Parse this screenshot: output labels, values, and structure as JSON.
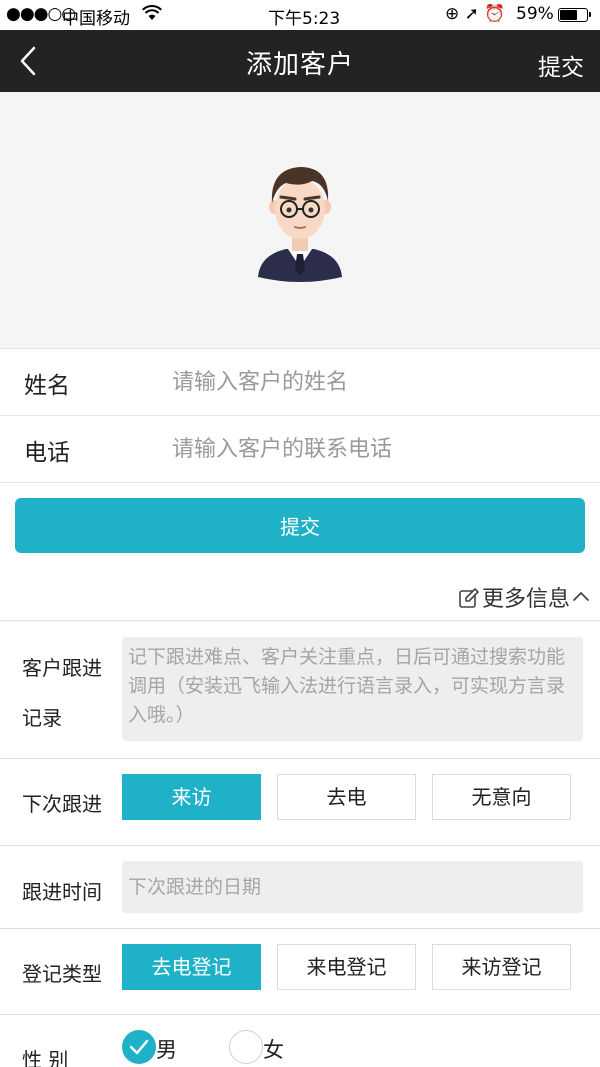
{
  "status_bar": {
    "signal": "●●●○○",
    "carrier": "中国移动",
    "time": "下午5:23",
    "icons": "⊕ ➚ ⏰",
    "battery_text": "59%",
    "battery_level": 0.59
  },
  "nav": {
    "title": "添加客户",
    "submit_label": "提交"
  },
  "form": {
    "name_label": "姓名",
    "name_placeholder": "请输入客户的姓名",
    "phone_label": "电话",
    "phone_placeholder": "请输入客户的联系电话",
    "submit_label": "提交"
  },
  "more_info": {
    "label": "更多信息"
  },
  "follow_record": {
    "label_line1": "客户跟进",
    "label_line2": "记录",
    "placeholder": "记下跟进难点、客户关注重点，日后可通过搜索功能调用（安装迅飞输入法进行语言录入，可实现方言录入哦。）"
  },
  "next_follow": {
    "label": "下次跟进",
    "options": [
      "来访",
      "去电",
      "无意向"
    ],
    "selected": "来访"
  },
  "follow_time": {
    "label": "跟进时间",
    "placeholder": "下次跟进的日期"
  },
  "register_type": {
    "label": "登记类型",
    "options": [
      "去电登记",
      "来电登记",
      "来访登记"
    ],
    "selected": "去电登记"
  },
  "gender": {
    "label": "性 别",
    "options": [
      "男",
      "女"
    ],
    "selected": "男"
  },
  "colors": {
    "accent": "#1fb1c7",
    "nav_bg": "#232323",
    "field_bg": "#eeeeee"
  }
}
